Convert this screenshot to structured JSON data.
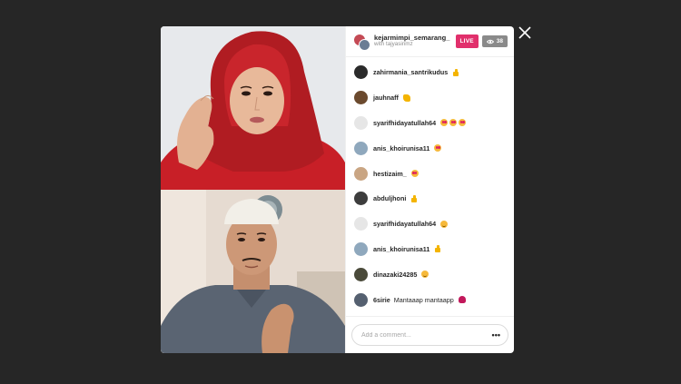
{
  "header": {
    "host_username": "kejarmimpi_semarang_",
    "with_text": "with tajyasinmz",
    "live_label": "LIVE",
    "viewer_count": "38"
  },
  "comments": [
    {
      "user": "zahirmania_santrikudus",
      "message": "",
      "emojis": [
        "thumbs"
      ],
      "avatar_color": "#2b2b2b"
    },
    {
      "user": "jauhnaff",
      "message": "",
      "emojis": [
        "clap"
      ],
      "avatar_color": "#6b4a2e"
    },
    {
      "user": "syarifhidayatullah64",
      "message": "",
      "emojis": [
        "heart-eyes",
        "heart-eyes",
        "heart-eyes"
      ],
      "avatar_color": "#e6e6e6"
    },
    {
      "user": "anis_khoirunisa11",
      "message": "",
      "emojis": [
        "heart-eyes"
      ],
      "avatar_color": "#8fa8bd"
    },
    {
      "user": "hestizaim_",
      "message": "",
      "emojis": [
        "heart-eyes"
      ],
      "avatar_color": "#c9a583"
    },
    {
      "user": "abduljhoni",
      "message": "",
      "emojis": [
        "thumbs"
      ],
      "avatar_color": "#3d3d3d"
    },
    {
      "user": "syarifhidayatullah64",
      "message": "",
      "emojis": [
        "smile"
      ],
      "avatar_color": "#e6e6e6"
    },
    {
      "user": "anis_khoirunisa11",
      "message": "",
      "emojis": [
        "thumbs"
      ],
      "avatar_color": "#8fa8bd"
    },
    {
      "user": "dinazaki24285",
      "message": "",
      "emojis": [
        "smile"
      ],
      "avatar_color": "#4a4a3a"
    },
    {
      "user": "6sirie",
      "message": "Mantaaap mantaapp",
      "emojis": [
        "rose"
      ],
      "avatar_color": "#556070"
    }
  ],
  "comment_box": {
    "placeholder": "Add a comment...",
    "more_label": "•••"
  },
  "colors": {
    "live": "#e1306c",
    "viewer_badge": "#8a8a8a",
    "backdrop": "#262626"
  }
}
